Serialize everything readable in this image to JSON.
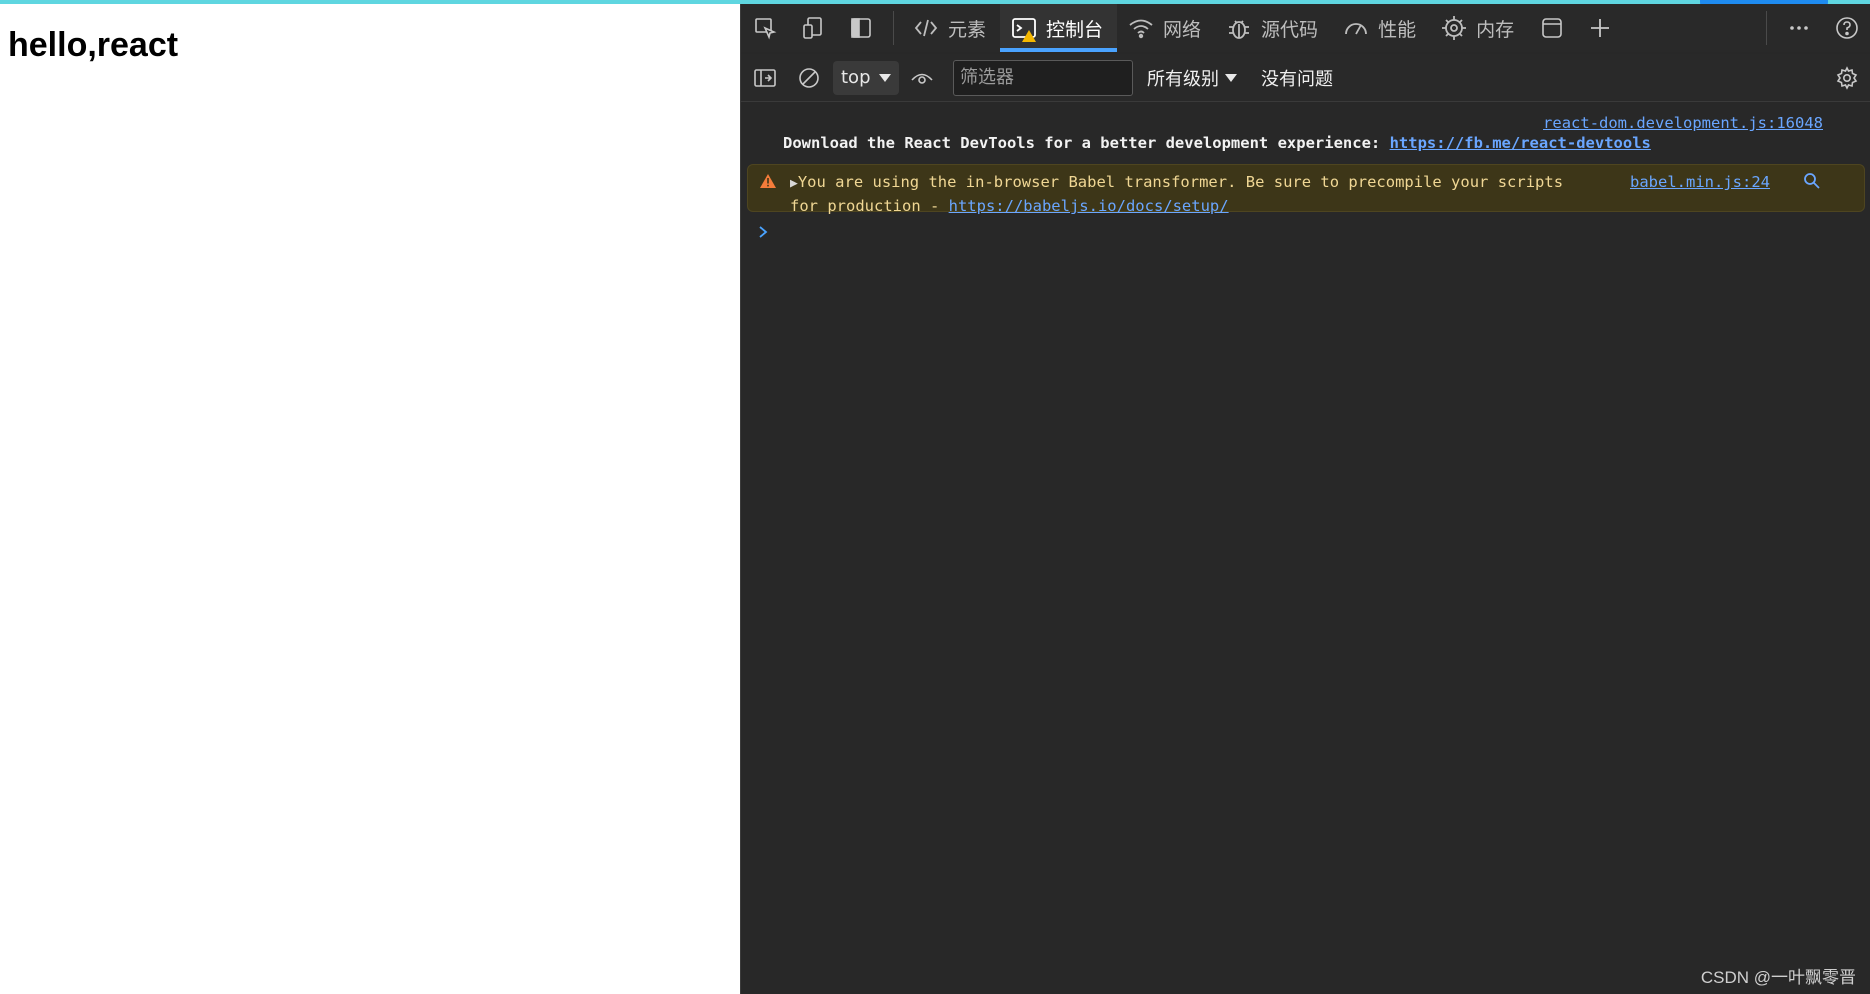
{
  "page": {
    "heading": "hello,react"
  },
  "devtools": {
    "tabs": [
      {
        "label": "元素",
        "icon": "code-brackets-icon"
      },
      {
        "label": "控制台",
        "icon": "console-icon",
        "active": true
      },
      {
        "label": "网络",
        "icon": "wifi-icon"
      },
      {
        "label": "源代码",
        "icon": "bug-icon"
      },
      {
        "label": "性能",
        "icon": "gauge-icon"
      },
      {
        "label": "内存",
        "icon": "chip-icon"
      }
    ],
    "toolbar": {
      "context": "top",
      "filter_placeholder": "筛选器",
      "levels": "所有级别",
      "issues": "没有问题"
    },
    "console": {
      "info": {
        "source": "react-dom.development.js:16048",
        "text": "Download the React DevTools for a better development experience: ",
        "link": "https://fb.me/react-devtools"
      },
      "warning": {
        "text_line1": "You are using the in-browser Babel transformer. Be sure to precompile your scripts",
        "text_line2": "for production - ",
        "link": "https://babeljs.io/docs/setup/",
        "source": "babel.min.js:24"
      }
    }
  },
  "watermark": "CSDN @一叶飘零晋",
  "colors": {
    "accent": "#4aa3ff",
    "warning_bg": "#3d3618",
    "warning_text": "#f0d794",
    "link": "#6aa6ff"
  }
}
